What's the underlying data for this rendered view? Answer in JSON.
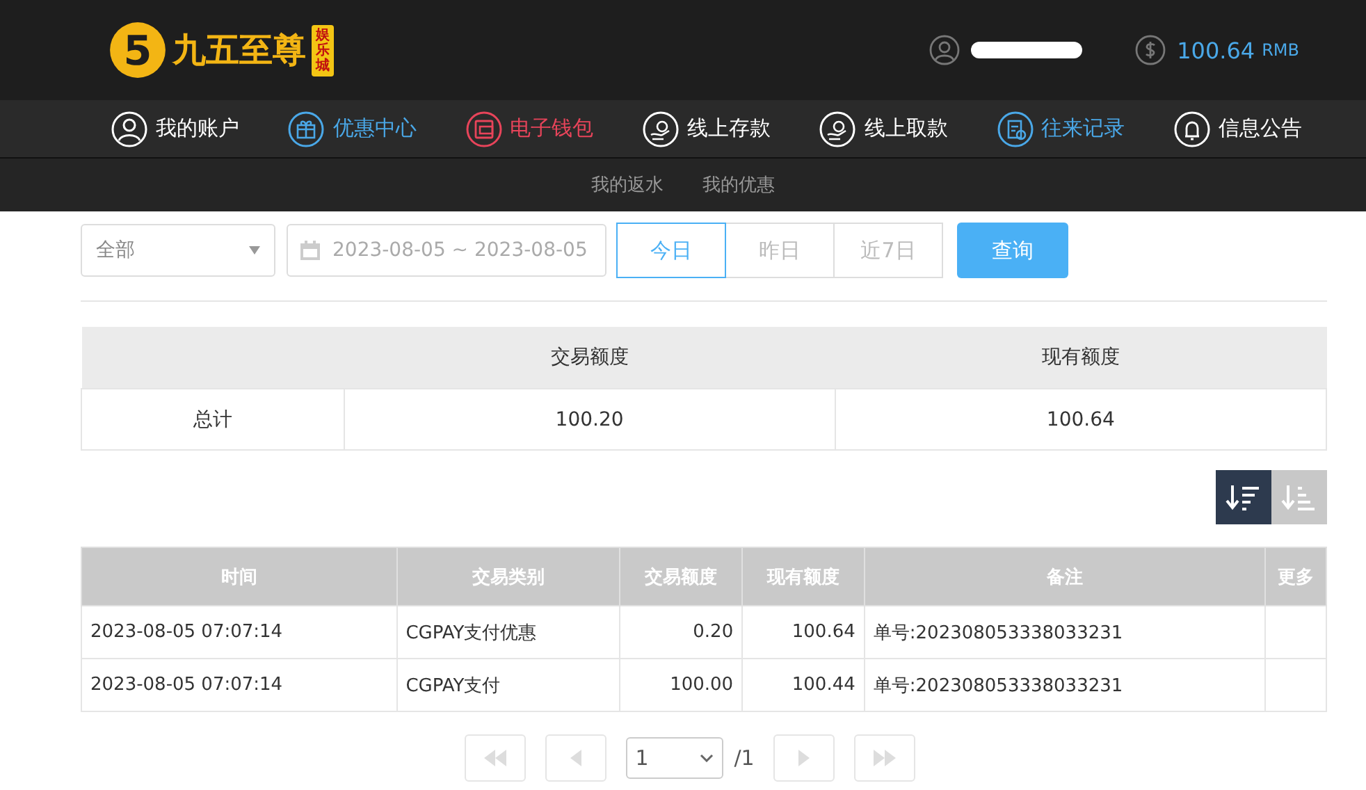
{
  "header": {
    "logo": {
      "mark": "5",
      "name": "九五至尊",
      "tag": "娱乐城"
    },
    "balance": "100.64",
    "currency": "RMB"
  },
  "nav": [
    {
      "label": "我的账户",
      "color": "#ffffff"
    },
    {
      "label": "优惠中心",
      "color": "#4aa8e8"
    },
    {
      "label": "电子钱包",
      "color": "#e8445a"
    },
    {
      "label": "线上存款",
      "color": "#ffffff"
    },
    {
      "label": "线上取款",
      "color": "#ffffff"
    },
    {
      "label": "往来记录",
      "color": "#4aa8e8"
    },
    {
      "label": "信息公告",
      "color": "#ffffff"
    }
  ],
  "subnav": [
    "我的返水",
    "我的优惠"
  ],
  "filter": {
    "type_select": "全部",
    "date_range": "2023-08-05 ~ 2023-08-05",
    "ranges": [
      {
        "label": "今日",
        "selected": true
      },
      {
        "label": "昨日",
        "selected": false
      },
      {
        "label": "近7日",
        "selected": false
      }
    ],
    "query_button": "查询"
  },
  "summary": {
    "columns": [
      "交易额度",
      "现有额度"
    ],
    "row": {
      "label": "总计",
      "values": [
        "100.20",
        "100.64"
      ]
    }
  },
  "sort_buttons": [
    {
      "kind": "desc",
      "selected": true
    },
    {
      "kind": "asc",
      "selected": false
    }
  ],
  "table": {
    "columns": [
      "时间",
      "交易类别",
      "交易额度",
      "现有额度",
      "备注",
      "更多"
    ],
    "rows": [
      [
        "2023-08-05 07:07:14",
        "CGPAY支付优惠",
        "0.20",
        "100.64",
        "单号:202308053338033231",
        ""
      ],
      [
        "2023-08-05 07:07:14",
        "CGPAY支付",
        "100.00",
        "100.44",
        "单号:202308053338033231",
        ""
      ]
    ]
  },
  "pagination": {
    "page": "1",
    "total": "/1"
  }
}
